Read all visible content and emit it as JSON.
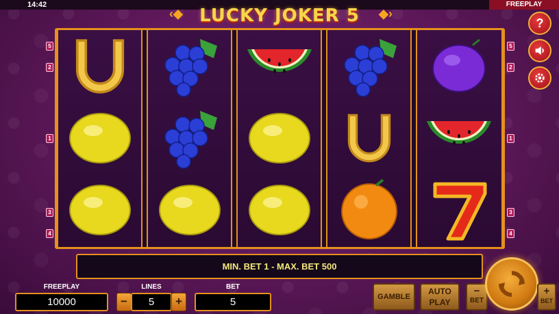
{
  "status_bar": {
    "time": "14:42",
    "mode": "FREEPLAY"
  },
  "game": {
    "title": "LUCKY JOKER 5"
  },
  "paylines": {
    "left": [
      "5",
      "2",
      "1",
      "3",
      "4"
    ],
    "right": [
      "5",
      "2",
      "1",
      "3",
      "4"
    ]
  },
  "reels": [
    [
      "horseshoe",
      "lemon",
      "lemon"
    ],
    [
      "grapes",
      "grapes",
      "lemon"
    ],
    [
      "watermelon",
      "lemon",
      "lemon"
    ],
    [
      "grapes",
      "horseshoe",
      "orange"
    ],
    [
      "plum",
      "watermelon",
      "seven"
    ]
  ],
  "info_message": "MIN. BET 1 - MAX. BET 500",
  "balance": {
    "label": "FREEPLAY",
    "value": "10000"
  },
  "lines": {
    "label": "LINES",
    "value": "5",
    "minus": "−",
    "plus": "+"
  },
  "bet": {
    "label": "BET",
    "value": "5"
  },
  "buttons": {
    "gamble": "GAMBLE",
    "autoplay_line1": "AUTO",
    "autoplay_line2": "PLAY",
    "bet_minus_sign": "−",
    "bet_minus_label": "BET",
    "bet_plus_sign": "+",
    "bet_plus_label": "BET"
  },
  "side_buttons": {
    "help_glyph": "?",
    "icons": [
      "help-icon",
      "sound-icon",
      "settings-icon"
    ]
  },
  "colors": {
    "frame_gold": "#e6911c",
    "background_purple": "#5b1757",
    "info_text": "#f4e87a",
    "side_button_red": "#c01a24"
  }
}
